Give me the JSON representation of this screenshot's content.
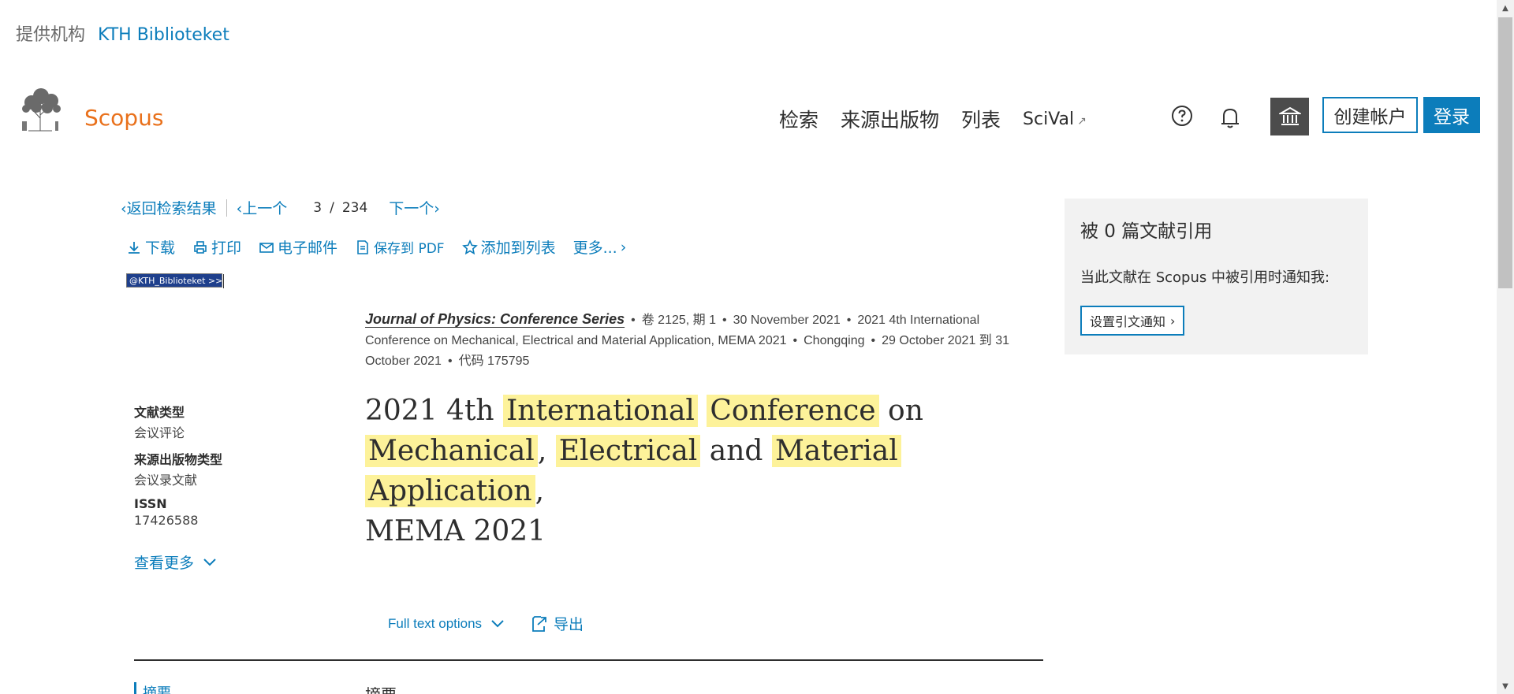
{
  "institution": {
    "label": "提供机构",
    "name": "KTH Biblioteket"
  },
  "brand": {
    "name": "Scopus",
    "color": "#e9711c"
  },
  "nav": {
    "search": "检索",
    "sources": "来源出版物",
    "lists": "列表",
    "scival": "SciVal"
  },
  "header_actions": {
    "create_account": "创建帐户",
    "login": "登录"
  },
  "pager": {
    "back": "返回检索结果",
    "prev": "上一个",
    "current": "3",
    "slash": "/",
    "total": "234",
    "next": "下一个"
  },
  "toolbar": {
    "download": "下载",
    "print": "打印",
    "email": "电子邮件",
    "save_pdf": "保存到 PDF",
    "add_list": "添加到列表",
    "more": "更多..."
  },
  "kth_link": "@KTH_Biblioteket >>",
  "source": {
    "journal": "Journal of Physics: Conference Series",
    "volume": "卷 2125, 期 1",
    "date": "30 November 2021",
    "conference": "2021 4th International Conference on Mechanical, Electrical and Material Application, MEMA 2021",
    "city": "Chongqing",
    "conf_dates": "29 October 2021 到 31 October 2021",
    "code": "代码 175795"
  },
  "title": {
    "t1": "2021 4th",
    "h1": "International",
    "h2": "Conference",
    "t2": "on",
    "h3": "Mechanical",
    "t3": ",",
    "h4": "Electrical",
    "t4": "and",
    "h5": "Material",
    "h6": "Application",
    "t5": ",",
    "t6": "MEMA 2021"
  },
  "metadata": {
    "doc_type_label": "文献类型",
    "doc_type": "会议评论",
    "source_type_label": "来源出版物类型",
    "source_type": "会议录文献",
    "issn_label": "ISSN",
    "issn": "17426588",
    "see_more": "查看更多"
  },
  "full_text": {
    "options": "Full text options",
    "export": "导出"
  },
  "bottom": {
    "left": "摘要",
    "mid": "摘要"
  },
  "citations": {
    "title": "被 0 篇文献引用",
    "notify": "当此文献在 Scopus 中被引用时通知我:",
    "set_alert": "设置引文通知"
  },
  "colors": {
    "link": "#0c7dbb",
    "highlight": "#fdf29a",
    "panel": "#f2f2f2",
    "dark_button": "#4c4c4c"
  }
}
